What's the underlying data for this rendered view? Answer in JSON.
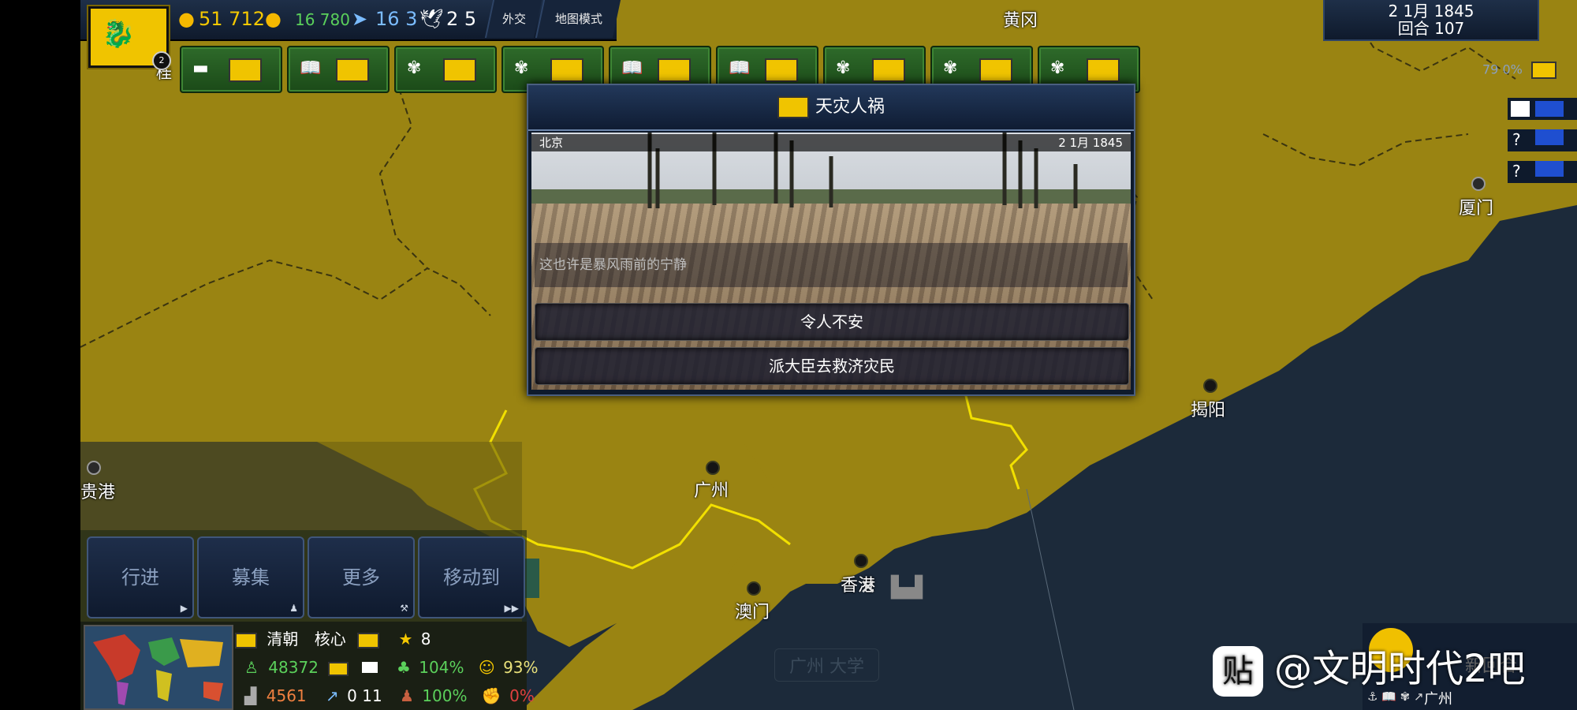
{
  "top_bar": {
    "gold": "51 712",
    "income": "16 780",
    "movement": "16 3",
    "diplomacy_points": "2 5",
    "diplomacy_btn": "外交",
    "map_mode_btn": "地图模式",
    "nation_badge": "2"
  },
  "date_panel": {
    "date": "2 1月 1845",
    "turn": "回合 107"
  },
  "right_panel": {
    "percent": "79 0%",
    "q1": "?",
    "q2": "?"
  },
  "event": {
    "title": "天灾人祸",
    "location": "北京",
    "date": "2 1月 1845",
    "flavor": "这也许是暴风雨前的宁静",
    "choices": [
      "令人不安",
      "派大臣去救济灾民"
    ]
  },
  "map_labels": {
    "huanggang": "黄冈",
    "xiamen": "厦门",
    "jieyang": "揭阳",
    "guangzhou": "广州",
    "hongkong": "香港",
    "macau": "澳门",
    "guigang": "贵港",
    "maoming": "茂名",
    "guangzhou_univ": "广州 大学",
    "partial_top_left": "桂"
  },
  "actions": {
    "march": "行进",
    "recruit": "募集",
    "more": "更多",
    "move_to": "移动到"
  },
  "nation_info": {
    "name": "清朝",
    "core": "核心",
    "stars": "8",
    "population": "48372",
    "growth": "104%",
    "happiness": "93%",
    "industry": "4561",
    "trend": "0 11",
    "manpower": "100%",
    "unrest": "0%"
  },
  "bottom_right": {
    "city": "广州",
    "overlay_text": "新回合"
  },
  "watermark": {
    "logo": "贴",
    "text": "@文明时代2吧"
  },
  "colors": {
    "land": "#9a8412",
    "sea": "#1c2a3a",
    "border_yellow": "#f2e000",
    "panel_blue": "#16243a",
    "slot_green": "#2e6a2a",
    "flag_yellow": "#f0c400"
  }
}
